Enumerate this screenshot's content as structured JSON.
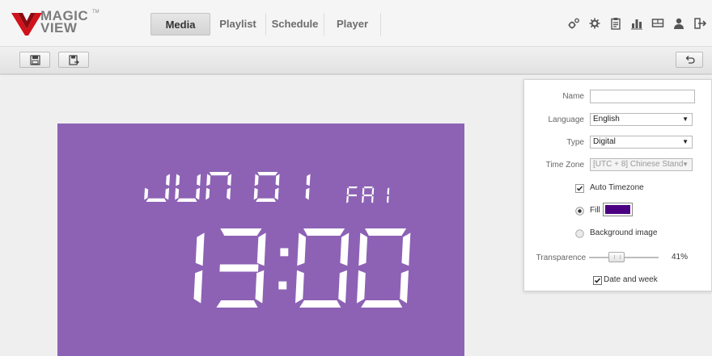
{
  "app": {
    "logo_line1": "MAGIC",
    "logo_line2": "VIEW",
    "logo_tm": "TM"
  },
  "tabs": [
    {
      "label": "Media",
      "active": true
    },
    {
      "label": "Playlist",
      "active": false
    },
    {
      "label": "Schedule",
      "active": false
    },
    {
      "label": "Player",
      "active": false
    }
  ],
  "top_icons": [
    "settings-gears-icon",
    "gear-icon",
    "clipboard-icon",
    "bar-chart-icon",
    "monitor-icon",
    "user-icon",
    "logout-icon"
  ],
  "toolbar": {
    "buttons": [
      "save-icon",
      "save-as-icon"
    ],
    "undo": "undo-icon"
  },
  "clock": {
    "date": "JUN 01",
    "weekday": "FRI",
    "time": "13:00",
    "background": "#8d62b5",
    "digit_color": "#ffffff"
  },
  "panel": {
    "name_label": "Name",
    "name_value": "",
    "language_label": "Language",
    "language_value": "English",
    "type_label": "Type",
    "type_value": "Digital",
    "timezone_label": "Time Zone",
    "timezone_value": "[UTC + 8] Chinese Stand",
    "auto_timezone_label": "Auto Timezone",
    "auto_timezone_checked": true,
    "fill_label": "Fill",
    "fill_selected": true,
    "fill_color": "#4b0082",
    "background_image_label": "Background image",
    "background_image_selected": false,
    "transparence_label": "Transparence",
    "transparence_value": 41,
    "transparence_text": "41%",
    "date_and_week_label": "Date and week",
    "date_and_week_checked": true
  }
}
